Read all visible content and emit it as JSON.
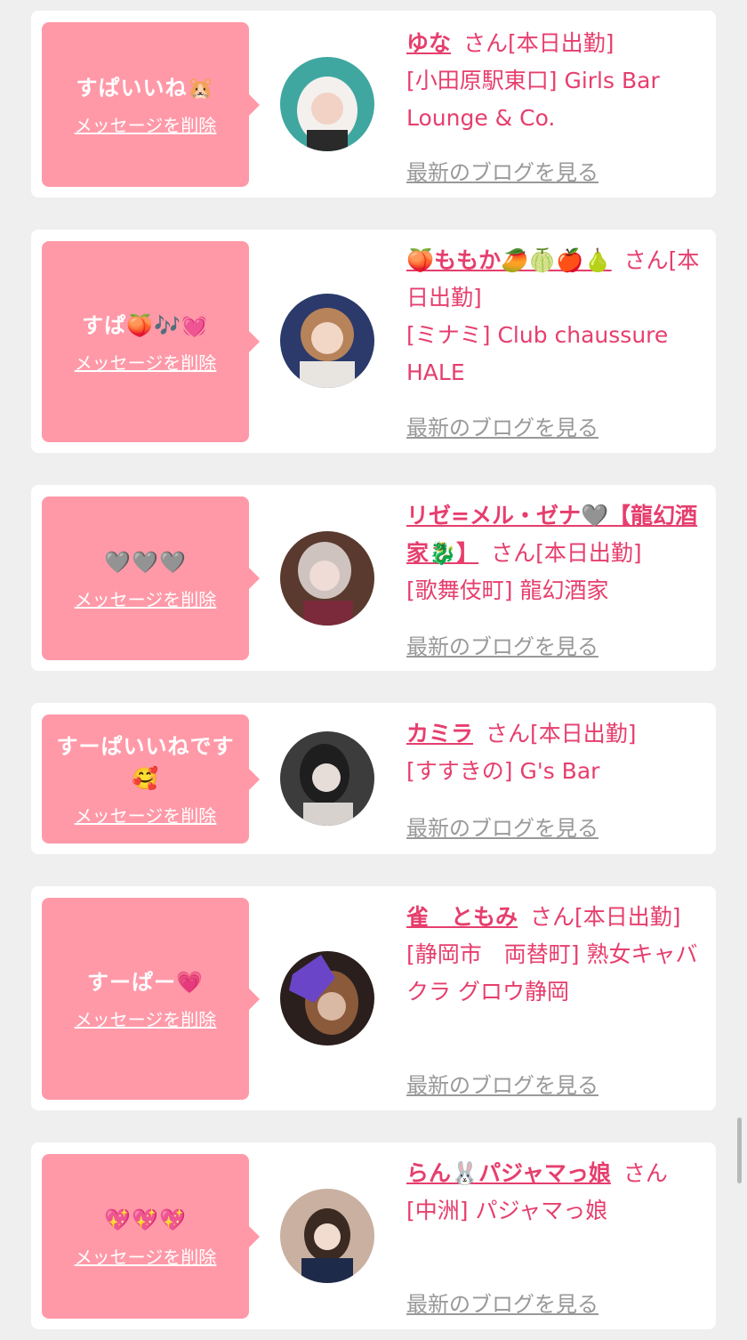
{
  "cards": [
    {
      "message": "すぱいいね🐹",
      "delete_label": "メッセージを削除",
      "name": "ゆな",
      "honorific": "さん",
      "status": "[本日出勤]",
      "shop": "[小田原駅東口] Girls Bar Lounge & Co.",
      "blog_label": "最新のブログを見る",
      "avatar_colors": [
        "#3fa7a0",
        "#f4f0ee"
      ]
    },
    {
      "message": "すぱ🍑🎶💓",
      "delete_label": "メッセージを削除",
      "name": "🍑ももか🥭🍈🍎🍐",
      "honorific": "さん",
      "status": "[本日出勤]",
      "shop": "[ミナミ] Club chaussure HALE",
      "blog_label": "最新のブログを見る",
      "avatar_colors": [
        "#2b3a6b",
        "#e8d6c8"
      ]
    },
    {
      "message": "🩶🩶🩶",
      "delete_label": "メッセージを削除",
      "name": "リゼ=メル・ゼナ🩶【龍幻酒家🐉】",
      "honorific": "さん",
      "status": "[本日出勤]",
      "shop": "[歌舞伎町] 龍幻酒家",
      "blog_label": "最新のブログを見る",
      "avatar_colors": [
        "#5a3a2e",
        "#cfc3c0"
      ]
    },
    {
      "message": "すーぱいいねです🥰",
      "delete_label": "メッセージを削除",
      "name": "カミラ",
      "honorific": "さん",
      "status": "[本日出勤]",
      "shop": "[すすきの] G's Bar",
      "blog_label": "最新のブログを見る",
      "avatar_colors": [
        "#3c3c3c",
        "#d8d2cf"
      ]
    },
    {
      "message": "すーぱー💗",
      "delete_label": "メッセージを削除",
      "name": "雀　ともみ",
      "honorific": "さん",
      "status": "[本日出勤]",
      "shop": "[静岡市　両替町] 熟女キャバクラ グロウ静岡",
      "blog_label": "最新のブログを見る",
      "avatar_colors": [
        "#2a1f1c",
        "#6b45c7"
      ]
    },
    {
      "message": "💖💖💖",
      "delete_label": "メッセージを削除",
      "name": "らん🐰パジャマっ娘",
      "honorific": "さん",
      "status": "",
      "shop": "[中洲] パジャマっ娘",
      "blog_label": "最新のブログを見る",
      "avatar_colors": [
        "#c9b0a0",
        "#1e2a4a"
      ]
    }
  ]
}
